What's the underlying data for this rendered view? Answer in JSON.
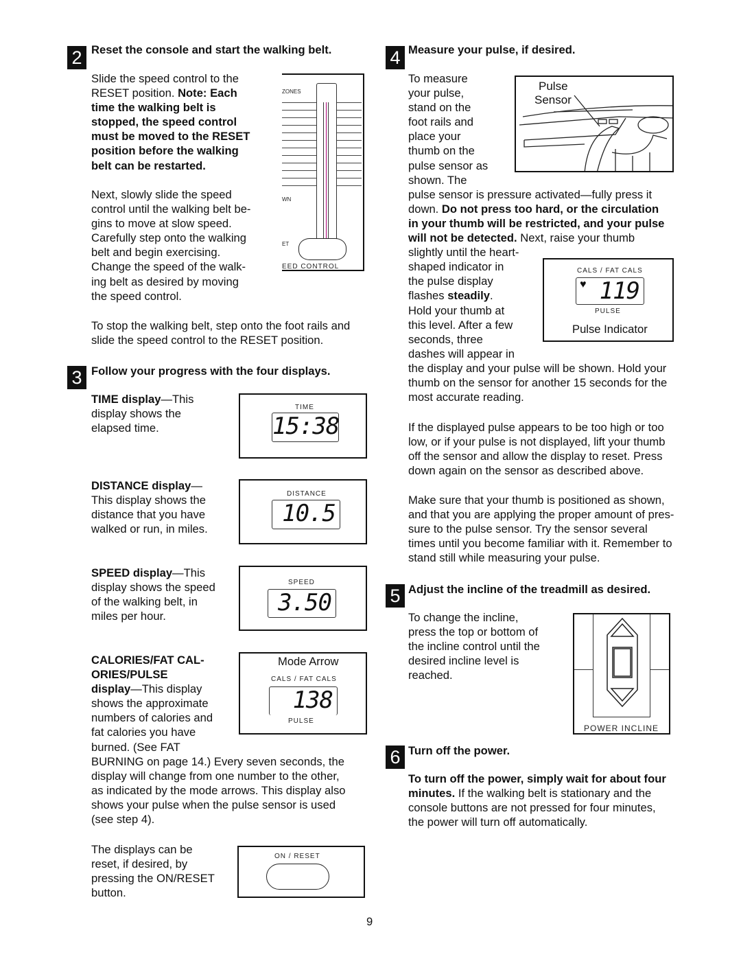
{
  "page_number": "9",
  "steps": [
    {
      "num": "2",
      "heading": "Reset the console and start the walking belt."
    },
    {
      "num": "3",
      "heading": "Follow your progress with the four displays."
    },
    {
      "num": "4",
      "heading": "Measure your pulse, if desired."
    },
    {
      "num": "5",
      "heading": "Adjust the incline of the treadmill as desired."
    },
    {
      "num": "6",
      "heading": "Turn off the power."
    }
  ],
  "blocks": [
    {
      "id": "s2p1",
      "lines": [
        [
          [
            "Slide the speed control to the",
            0
          ]
        ],
        [
          [
            "RESET position. ",
            0
          ],
          [
            "Note: Each",
            1
          ]
        ],
        [
          [
            "time the walking belt is",
            1
          ]
        ],
        [
          [
            "stopped, the speed control",
            1
          ]
        ],
        [
          [
            "must be moved to the RESET",
            1
          ]
        ],
        [
          [
            "position before the walking",
            1
          ]
        ],
        [
          [
            "belt can be restarted.",
            1
          ]
        ]
      ]
    },
    {
      "id": "s2p2",
      "lines": [
        [
          [
            "Next, slowly slide the speed",
            0
          ]
        ],
        [
          [
            "control until the walking belt be-",
            0
          ]
        ],
        [
          [
            "gins to move at slow speed.",
            0
          ]
        ],
        [
          [
            "Carefully step onto the walking",
            0
          ]
        ],
        [
          [
            "belt and begin exercising.",
            0
          ]
        ],
        [
          [
            "Change the speed of the walk-",
            0
          ]
        ],
        [
          [
            "ing belt as desired by moving",
            0
          ]
        ],
        [
          [
            "the speed control.",
            0
          ]
        ]
      ]
    },
    {
      "id": "s2p3",
      "lines": [
        [
          [
            "To stop the walking belt, step onto the foot rails and",
            0
          ]
        ],
        [
          [
            "slide the speed control to the RESET position.",
            0
          ]
        ]
      ]
    },
    {
      "id": "time",
      "lines": [
        [
          [
            "TIME display",
            1
          ],
          [
            "—This",
            0
          ]
        ],
        [
          [
            "display shows the",
            0
          ]
        ],
        [
          [
            "elapsed time.",
            0
          ]
        ]
      ]
    },
    {
      "id": "distance",
      "lines": [
        [
          [
            "DISTANCE display",
            1
          ],
          [
            "—",
            0
          ]
        ],
        [
          [
            "This display shows the",
            0
          ]
        ],
        [
          [
            "distance that you have",
            0
          ]
        ],
        [
          [
            "walked or run, in miles.",
            0
          ]
        ]
      ]
    },
    {
      "id": "speed",
      "lines": [
        [
          [
            "SPEED display",
            1
          ],
          [
            "—This",
            0
          ]
        ],
        [
          [
            "display shows the speed",
            0
          ]
        ],
        [
          [
            "of the walking belt, in",
            0
          ]
        ],
        [
          [
            "miles per hour.",
            0
          ]
        ]
      ]
    },
    {
      "id": "calories",
      "lines": [
        [
          [
            "CALORIES/FAT CAL-",
            1
          ]
        ],
        [
          [
            "ORIES/PULSE",
            1
          ]
        ],
        [
          [
            "display",
            1
          ],
          [
            "—This display",
            0
          ]
        ],
        [
          [
            "shows the approximate",
            0
          ]
        ],
        [
          [
            "numbers of calories and",
            0
          ]
        ],
        [
          [
            "fat calories you have",
            0
          ]
        ],
        [
          [
            "burned. (See FAT",
            0
          ]
        ],
        [
          [
            "BURNING on page 14.) Every seven seconds, the",
            0
          ]
        ],
        [
          [
            "display will change from one number to the other,",
            0
          ]
        ],
        [
          [
            "as indicated by the mode arrows. This display also",
            0
          ]
        ],
        [
          [
            "shows your pulse when the pulse sensor is used",
            0
          ]
        ],
        [
          [
            "(see step 4).",
            0
          ]
        ]
      ]
    },
    {
      "id": "reset",
      "lines": [
        [
          [
            "The displays can be",
            0
          ]
        ],
        [
          [
            "reset, if desired, by",
            0
          ]
        ],
        [
          [
            "pressing the ON/RESET",
            0
          ]
        ],
        [
          [
            "button.",
            0
          ]
        ]
      ]
    },
    {
      "id": "s4p1",
      "lines": [
        [
          [
            "To measure",
            0
          ]
        ],
        [
          [
            "your pulse,",
            0
          ]
        ],
        [
          [
            "stand on the",
            0
          ]
        ],
        [
          [
            "foot rails and",
            0
          ]
        ],
        [
          [
            "place your",
            0
          ]
        ],
        [
          [
            "thumb on the",
            0
          ]
        ],
        [
          [
            "pulse sensor as",
            0
          ]
        ],
        [
          [
            "shown. The",
            0
          ]
        ],
        [
          [
            "pulse sensor is pressure activated—fully press it",
            0
          ]
        ],
        [
          [
            "down. ",
            0
          ],
          [
            "Do not press too hard, or the circulation",
            1
          ]
        ],
        [
          [
            "in your thumb will be restricted, and your pulse",
            1
          ]
        ],
        [
          [
            "will not be detected.",
            1
          ],
          [
            " Next, raise your thumb",
            0
          ]
        ],
        [
          [
            "slightly until the heart-",
            0
          ]
        ],
        [
          [
            "shaped indicator in",
            0
          ]
        ],
        [
          [
            "the pulse display",
            0
          ]
        ],
        [
          [
            "flashes ",
            0
          ],
          [
            "steadily",
            1
          ],
          [
            ".",
            0
          ]
        ],
        [
          [
            "Hold your thumb at",
            0
          ]
        ],
        [
          [
            "this level. After a few",
            0
          ]
        ],
        [
          [
            "seconds, three",
            0
          ]
        ],
        [
          [
            "dashes will appear in",
            0
          ]
        ],
        [
          [
            "the display and your pulse will be shown. Hold your",
            0
          ]
        ],
        [
          [
            "thumb on the sensor for another 15 seconds for the",
            0
          ]
        ],
        [
          [
            "most accurate reading.",
            0
          ]
        ]
      ]
    },
    {
      "id": "s4p2",
      "lines": [
        [
          [
            "If the displayed pulse appears to be too high or too",
            0
          ]
        ],
        [
          [
            "low, or if your pulse is not displayed, lift your thumb",
            0
          ]
        ],
        [
          [
            "off the sensor and allow the display to reset. Press",
            0
          ]
        ],
        [
          [
            "down again on the sensor as described above.",
            0
          ]
        ]
      ]
    },
    {
      "id": "s4p3",
      "lines": [
        [
          [
            "Make sure that your thumb is positioned as shown,",
            0
          ]
        ],
        [
          [
            "and that you are applying the proper amount of pres-",
            0
          ]
        ],
        [
          [
            "sure to the pulse sensor. Try the sensor several",
            0
          ]
        ],
        [
          [
            "times until you become familiar with it. Remember to",
            0
          ]
        ],
        [
          [
            "stand still while measuring your pulse.",
            0
          ]
        ]
      ]
    },
    {
      "id": "s5p1",
      "lines": [
        [
          [
            "To change the incline,",
            0
          ]
        ],
        [
          [
            "press the top or bottom of",
            0
          ]
        ],
        [
          [
            "the incline control until the",
            0
          ]
        ],
        [
          [
            "desired incline level is",
            0
          ]
        ],
        [
          [
            "reached.",
            0
          ]
        ]
      ]
    },
    {
      "id": "s6p1",
      "lines": [
        [
          [
            "To turn off the power, simply wait for about four",
            1
          ]
        ],
        [
          [
            "minutes.",
            1
          ],
          [
            " If the walking belt is stationary and the",
            0
          ]
        ],
        [
          [
            "console buttons are not pressed for four minutes,",
            0
          ]
        ],
        [
          [
            "the power will turn off automatically.",
            0
          ]
        ]
      ]
    }
  ],
  "figures": {
    "speed_control": {
      "labels": [
        "ZONES",
        "WN",
        "ET",
        "EED CONTROL"
      ]
    },
    "time": {
      "label": "TIME",
      "value": "15:38"
    },
    "distance": {
      "label": "DISTANCE",
      "value": "10.5"
    },
    "speed": {
      "label": "SPEED",
      "value": "3.50"
    },
    "calories": {
      "callout": "Mode Arrow",
      "label": "CALS / FAT CALS",
      "value": "138",
      "sublabel": "PULSE"
    },
    "reset": {
      "label": "ON / RESET"
    },
    "pulse_sensor": {
      "callout_line1": "Pulse",
      "callout_line2": "Sensor"
    },
    "pulse_indicator": {
      "label": "CALS / FAT CALS",
      "value": "119",
      "sublabel": "PULSE",
      "caption": "Pulse Indicator",
      "icon": "heart-icon"
    },
    "incline": {
      "label": "POWER INCLINE"
    }
  }
}
